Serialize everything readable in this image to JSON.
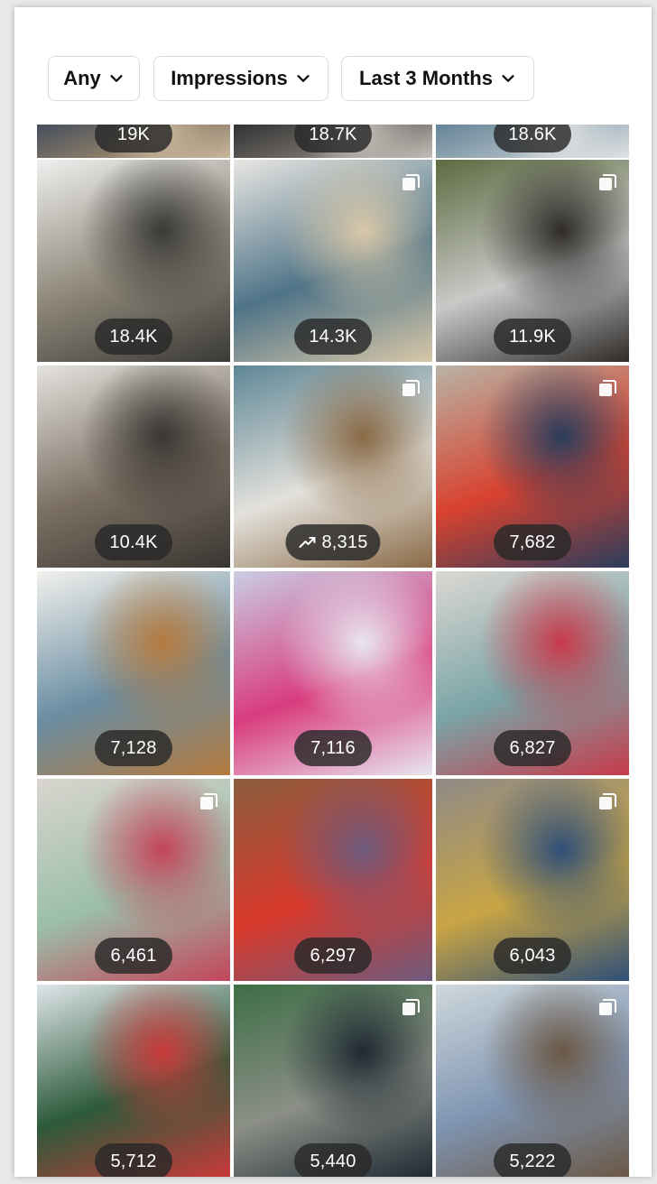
{
  "filters": [
    {
      "label": "Any"
    },
    {
      "label": "Impressions"
    },
    {
      "label": "Last 3 Months"
    }
  ],
  "tiles": [
    {
      "value": "19K",
      "trend": false,
      "colors": [
        "#3d4a5c",
        "#8a7b68",
        "#c9b79b"
      ]
    },
    {
      "value": "18.7K",
      "trend": false,
      "colors": [
        "#2b2b2b",
        "#6e6a66",
        "#c4bfb8"
      ]
    },
    {
      "value": "18.6K",
      "trend": false,
      "colors": [
        "#5f7e93",
        "#9fb1bb",
        "#e0e2e3"
      ]
    },
    {
      "value": "18.4K",
      "trend": false,
      "colors": [
        "#efefee",
        "#8c8577",
        "#3b3a37"
      ]
    },
    {
      "value": "14.3K",
      "trend": false,
      "colors": [
        "#e8e6e2",
        "#4f7488",
        "#d8c7a8"
      ]
    },
    {
      "value": "11.9K",
      "trend": false,
      "colors": [
        "#5d6b41",
        "#c9c9c7",
        "#2f2c2a"
      ]
    },
    {
      "value": "10.4K",
      "trend": false,
      "colors": [
        "#e5e3df",
        "#7a6f62",
        "#3a3632"
      ]
    },
    {
      "value": "8,315",
      "trend": true,
      "colors": [
        "#5f8796",
        "#e3e1dc",
        "#8a6a46"
      ]
    },
    {
      "value": "7,682",
      "trend": false,
      "colors": [
        "#b9b3a5",
        "#d8422f",
        "#2a3d5c"
      ]
    },
    {
      "value": "7,128",
      "trend": false,
      "colors": [
        "#f2f1ed",
        "#6a8ea3",
        "#b57a3e"
      ]
    },
    {
      "value": "7,116",
      "trend": false,
      "colors": [
        "#c9cde3",
        "#d93c7e",
        "#e8e6f1"
      ]
    },
    {
      "value": "6,827",
      "trend": false,
      "colors": [
        "#dcd8d3",
        "#7aa4a6",
        "#c73a4b"
      ]
    },
    {
      "value": "6,461",
      "trend": false,
      "colors": [
        "#d9d5cf",
        "#9bbfa9",
        "#c3455a"
      ]
    },
    {
      "value": "6,297",
      "trend": false,
      "colors": [
        "#8a5d3e",
        "#d93a2c",
        "#6d5a7d"
      ]
    },
    {
      "value": "6,043",
      "trend": false,
      "colors": [
        "#8f8a86",
        "#c9a544",
        "#2f4f78"
      ]
    },
    {
      "value": "5,712",
      "trend": false,
      "colors": [
        "#dfe6ea",
        "#2c5a3a",
        "#c83a3a"
      ]
    },
    {
      "value": "5,440",
      "trend": false,
      "colors": [
        "#3d6e45",
        "#8b8f86",
        "#1f2a33"
      ]
    },
    {
      "value": "5,222",
      "trend": false,
      "colors": [
        "#cfd8dc",
        "#7f95b2",
        "#6b5846"
      ]
    }
  ],
  "icons": {
    "chevron": "chevron-down-icon",
    "trend": "trending-up-icon",
    "multi": "carousel-icon"
  }
}
